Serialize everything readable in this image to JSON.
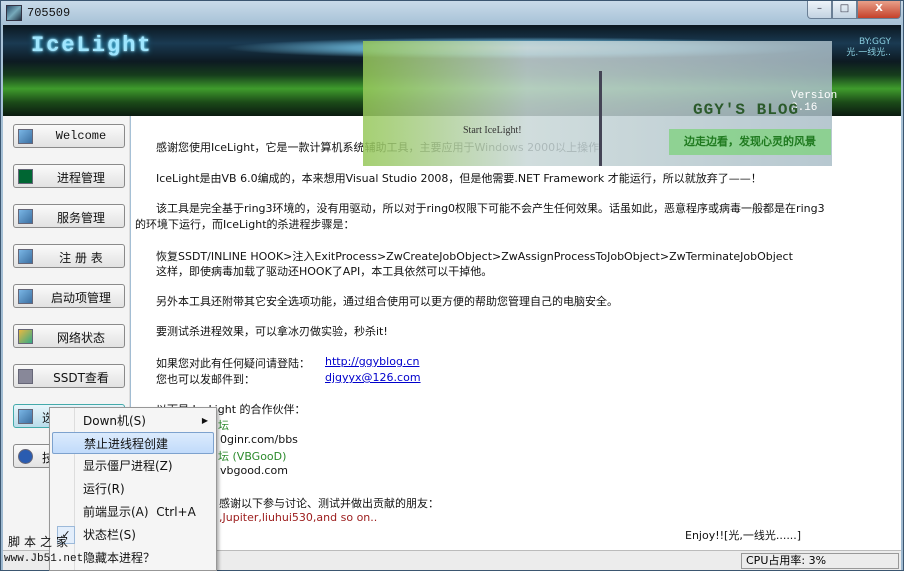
{
  "window": {
    "title": "705509",
    "min": "–",
    "max": "□",
    "close": "X"
  },
  "banner": {
    "logo": "IceLight",
    "by": "BY:GGY",
    "author": "光.一线光..",
    "version": "Version 3.16",
    "blog": "GGY'S BLOG",
    "start": "Start IceLight!",
    "slogan": "边走边看，发现心灵的风景"
  },
  "sidebar": {
    "items": [
      {
        "label": "Welcome",
        "icon": "picture-icon"
      },
      {
        "label": "进程管理",
        "icon": "monitor-icon"
      },
      {
        "label": "服务管理",
        "icon": "services-icon"
      },
      {
        "label": "注 册 表",
        "icon": "registry-icon"
      },
      {
        "label": "启动项管理",
        "icon": "startup-icon"
      },
      {
        "label": "网络状态",
        "icon": "network-icon"
      },
      {
        "label": "SSDT查看",
        "icon": "ssdt-icon"
      },
      {
        "label": "选",
        "icon": "options-icon"
      },
      {
        "label": "技",
        "icon": "help-icon"
      }
    ]
  },
  "content": {
    "p1": "感谢您使用IceLight，它是一款计算机系统辅助工具，主要应用于Windows 2000以上操作",
    "p2": "IceLight是由VB 6.0编成的，本来想用Visual Studio 2008，但是他需要.NET Framework 才能运行，所以就放弃了——！",
    "p3a": "该工具是完全基于ring3环境的，没有用驱动，所以对于ring0权限下可能不会产生任何效果。话虽如此，恶意程序或病毒一般都是在ring3",
    "p3b": "的环境下运行，而IceLight的杀进程步骤是：",
    "p4a": "恢复SSDT/INLINE HOOK>注入ExitProcess>ZwCreateJobObject>ZwAssignProcessToJobObject>ZwTerminateJobObject",
    "p4b": "这样，即使病毒加载了驱动还HOOK了API，本工具依然可以干掉他。",
    "p5": "另外本工具还附带其它安全选项功能，通过组合使用可以更方便的帮助您管理自己的电脑安全。",
    "p6": "要测试杀进程效果，可以拿冰刃做实验，秒杀it!",
    "q1": "如果您对此有任何疑问请登陆：",
    "q1link": "http://ggyblog.cn",
    "q2": "您也可以发邮件到：",
    "q2link": "djgyyx@126.com",
    "partners": "以下是 IceLight 的合作伙伴：",
    "partner1": "坛",
    "partner1url": "0ginr.com/bbs",
    "partner2": "坛 (VBGooD)",
    "partner2url": "vbgood.com",
    "thanks": "感谢以下参与讨论、测试并做出贡献的朋友：",
    "friends": ",Jupiter,liuhui530,and so on..",
    "enjoy": "Enjoy!![光,一线光......]"
  },
  "status": {
    "cpu": "CPU占用率: 3%"
  },
  "context_menu": {
    "items": [
      {
        "label": "Down机(S)",
        "submenu": true
      },
      {
        "label": "禁止进线程创建",
        "highlighted": true
      },
      {
        "label": "显示僵尸进程(Z)"
      },
      {
        "label": "运行(R)"
      },
      {
        "label": "前端显示(A)  Ctrl+A"
      },
      {
        "label": "状态栏(S)",
        "checked": true
      },
      {
        "label": "隐藏本进程？"
      }
    ]
  },
  "watermark": {
    "line1": "脚本之家",
    "line2": "www.Jb51.net"
  }
}
